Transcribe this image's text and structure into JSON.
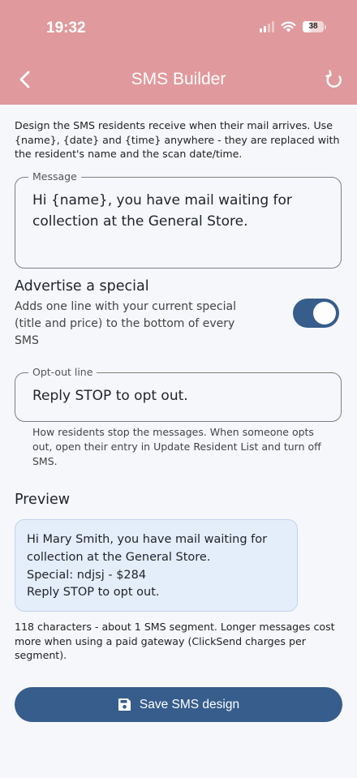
{
  "status_bar": {
    "time": "19:32",
    "battery": "38"
  },
  "header": {
    "title": "SMS Builder"
  },
  "intro": "Design the SMS residents receive when their mail arrives. Use {name}, {date} and {time} anywhere - they are replaced with the resident's name and the scan date/time.",
  "message": {
    "label": "Message",
    "value": "Hi {name}, you have mail waiting for collection at the General Store."
  },
  "advertise": {
    "title": "Advertise a special",
    "description": "Adds one line with your current special (title and price) to the bottom of every SMS",
    "enabled": true
  },
  "optout": {
    "label": "Opt-out line",
    "value": "Reply STOP to opt out.",
    "help": "How residents stop the messages. When someone opts out, open their entry in Update Resident List and turn off SMS."
  },
  "preview": {
    "title": "Preview",
    "lines": [
      "Hi Mary Smith, you have mail waiting for",
      "collection at the General Store.",
      "Special: ndjsj - $284",
      "Reply STOP to opt out."
    ]
  },
  "count_text": "118 characters - about 1 SMS segment. Longer messages cost more when using a paid gateway (ClickSend charges per segment).",
  "save_button": {
    "label": "Save SMS design"
  },
  "colors": {
    "header": "#e0999c",
    "primary": "#365d8b",
    "preview_bg": "#e4edfa"
  }
}
